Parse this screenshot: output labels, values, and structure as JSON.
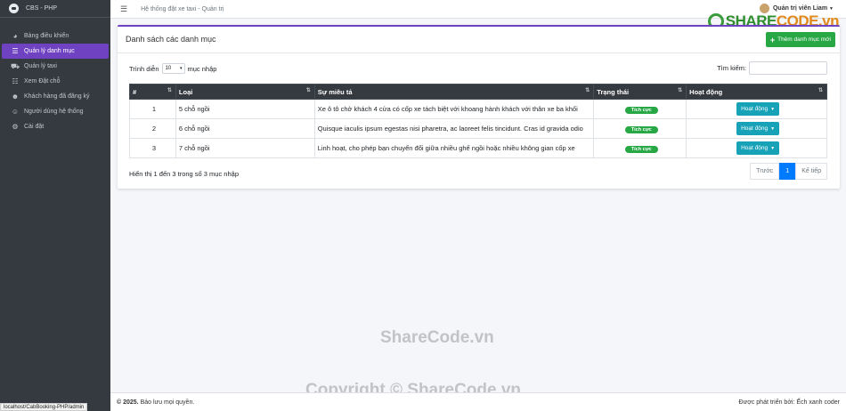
{
  "brand": {
    "title": "CBS - PHP"
  },
  "sidebar": {
    "items": [
      {
        "label": "Bảng điều khiển",
        "icon": "dashboard-icon",
        "glyph": "◕"
      },
      {
        "label": "Quản lý danh mục",
        "icon": "list-icon",
        "glyph": "☰",
        "active": true
      },
      {
        "label": "Quản lý taxi",
        "icon": "car-icon",
        "glyph": "⛟"
      },
      {
        "label": "Xem Đặt chỗ",
        "icon": "list-icon",
        "glyph": "☷"
      },
      {
        "label": "Khách hàng đã đăng ký",
        "icon": "users-icon",
        "glyph": "☻"
      },
      {
        "label": "Người dùng hệ thống",
        "icon": "users-cog-icon",
        "glyph": "☺"
      },
      {
        "label": "Cài đặt",
        "icon": "gears-icon",
        "glyph": "⚙"
      }
    ]
  },
  "statusbar": {
    "url": "localhost/CabBooking-PHP/admin"
  },
  "topbar": {
    "title": "Hệ thống đặt xe taxi - Quản trị",
    "user": "Quản trị viên Liam"
  },
  "card": {
    "title": "Danh sách các danh mục",
    "add_label": "Thêm danh mục mới",
    "length_prefix": "Trình diễn",
    "length_value": "10",
    "length_suffix": "mục nhập",
    "search_label": "Tìm kiếm:",
    "search_value": ""
  },
  "table": {
    "headers": [
      "#",
      "Loại",
      "Sự miêu tả",
      "Trạng thái",
      "Hoạt động"
    ],
    "rows": [
      {
        "num": "1",
        "type": "5 chỗ ngồi",
        "desc": "Xe ô tô chở khách 4 cửa có cốp xe tách biệt với khoang hành khách với thân xe ba khối",
        "status": "Tích cực",
        "action": "Hoạt động"
      },
      {
        "num": "2",
        "type": "6 chỗ ngồi",
        "desc": "Quisque iaculis ipsum egestas nisi pharetra, ac laoreet felis tincidunt. Cras id gravida odio",
        "status": "Tích cực",
        "action": "Hoạt động"
      },
      {
        "num": "3",
        "type": "7 chỗ ngồi",
        "desc": "Linh hoạt, cho phép bạn chuyển đổi giữa nhiều ghế ngồi hoặc nhiều không gian cốp xe",
        "status": "Tích cực",
        "action": "Hoạt động"
      }
    ]
  },
  "info": "Hiển thị 1 đến 3 trong số 3 mục nhập",
  "pager": {
    "prev": "Trước",
    "current": "1",
    "next": "Kế tiếp"
  },
  "footer": {
    "copy_year": "© 2025.",
    "copy_rest": " Bảo lưu mọi quyền.",
    "right": "Được phát triển bởi: Ếch xanh coder"
  },
  "watermarks": {
    "logo_a": "SHARE",
    "logo_b": "CODE.vn",
    "center": "ShareCode.vn",
    "bottom": "Copyright © ShareCode.vn"
  },
  "colors": {
    "accent": "#6f42c1",
    "sidebar": "#343a40",
    "success": "#28a745",
    "info": "#17a2b8",
    "primary": "#007bff"
  }
}
